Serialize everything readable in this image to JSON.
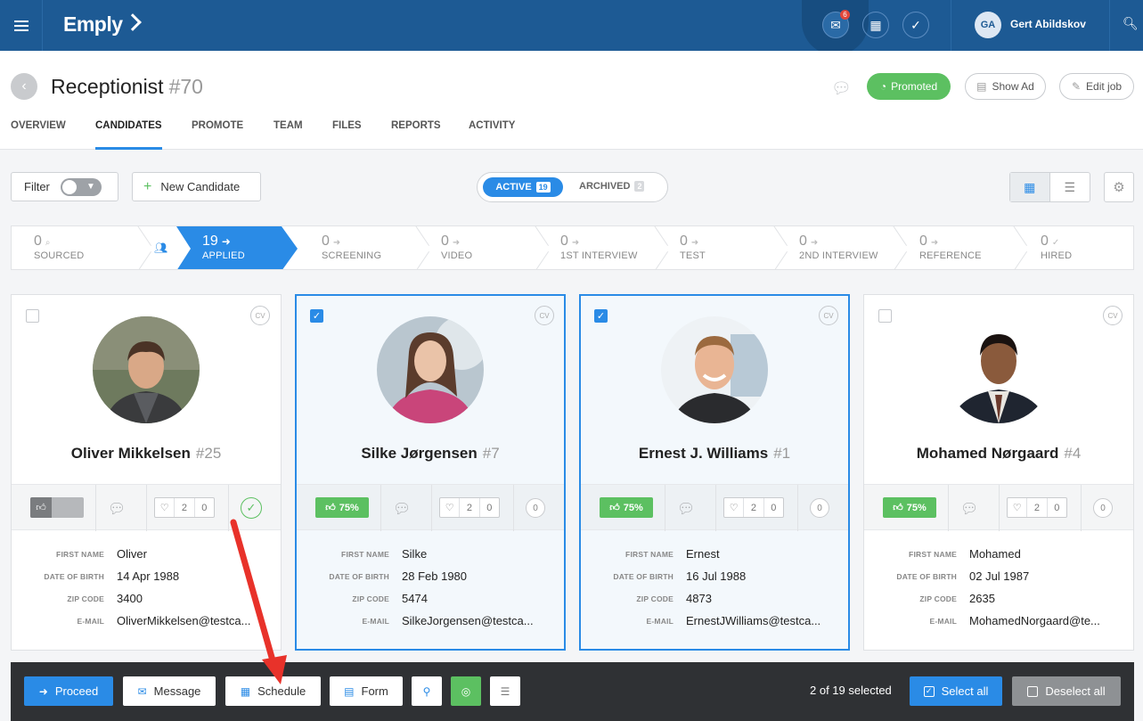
{
  "topbar": {
    "logo": "Emply",
    "notification_count": "6",
    "user_initials": "GA",
    "user_name": "Gert Abildskov"
  },
  "header": {
    "job_title": "Receptionist",
    "job_number": "#70",
    "promoted_label": "Promoted",
    "show_ad_label": "Show Ad",
    "edit_job_label": "Edit job",
    "tabs": [
      {
        "label": "OVERVIEW",
        "active": false
      },
      {
        "label": "CANDIDATES",
        "active": true
      },
      {
        "label": "PROMOTE",
        "active": false
      },
      {
        "label": "TEAM",
        "active": false
      },
      {
        "label": "FILES",
        "active": false
      },
      {
        "label": "REPORTS",
        "active": false
      },
      {
        "label": "ACTIVITY",
        "active": false
      }
    ]
  },
  "toolbar": {
    "filter_label": "Filter",
    "new_candidate_label": "New Candidate",
    "active_label": "ACTIVE",
    "active_count": "19",
    "archived_label": "ARCHIVED",
    "archived_count": "2"
  },
  "pipeline": [
    {
      "count": "0",
      "label": "SOURCED"
    },
    {
      "count": "19",
      "label": "APPLIED",
      "active": true
    },
    {
      "count": "0",
      "label": "SCREENING"
    },
    {
      "count": "0",
      "label": "VIDEO"
    },
    {
      "count": "0",
      "label": "1ST INTERVIEW"
    },
    {
      "count": "0",
      "label": "TEST"
    },
    {
      "count": "0",
      "label": "2ND INTERVIEW"
    },
    {
      "count": "0",
      "label": "REFERENCE"
    },
    {
      "count": "0",
      "label": "HIRED"
    }
  ],
  "field_labels": {
    "first_name": "FIRST NAME",
    "dob": "DATE OF BIRTH",
    "zip": "ZIP CODE",
    "email": "E-MAIL"
  },
  "cards": [
    {
      "name": "Oliver Mikkelsen",
      "num": "#25",
      "selected": false,
      "rating": null,
      "hearts": "2",
      "comments": "0",
      "cv": "CV",
      "first_name": "Oliver",
      "dob": "14 Apr 1988",
      "zip": "3400",
      "email": "OliverMikkelsen@testca..."
    },
    {
      "name": "Silke Jørgensen",
      "num": "#7",
      "selected": true,
      "rating": "75%",
      "hearts": "2",
      "comments": "0",
      "extra": "0",
      "cv": "CV",
      "first_name": "Silke",
      "dob": "28 Feb 1980",
      "zip": "5474",
      "email": "SilkeJorgensen@testca..."
    },
    {
      "name": "Ernest J. Williams",
      "num": "#1",
      "selected": true,
      "rating": "75%",
      "hearts": "2",
      "comments": "0",
      "extra": "0",
      "cv": "CV",
      "first_name": "Ernest",
      "dob": "16 Jul 1988",
      "zip": "4873",
      "email": "ErnestJWilliams@testca..."
    },
    {
      "name": "Mohamed Nørgaard",
      "num": "#4",
      "selected": false,
      "rating": "75%",
      "hearts": "2",
      "comments": "0",
      "extra": "0",
      "cv": "CV",
      "first_name": "Mohamed",
      "dob": "02 Jul 1987",
      "zip": "2635",
      "email": "MohamedNorgaard@te..."
    }
  ],
  "bottombar": {
    "proceed": "Proceed",
    "message": "Message",
    "schedule": "Schedule",
    "form": "Form",
    "selection_text": "2 of 19 selected",
    "select_all": "Select all",
    "deselect_all": "Deselect all"
  },
  "colors": {
    "topbar": "#1d5a94",
    "accent_blue": "#2a8be6",
    "accent_green": "#5cc061",
    "annotation_arrow": "#e8322a"
  }
}
